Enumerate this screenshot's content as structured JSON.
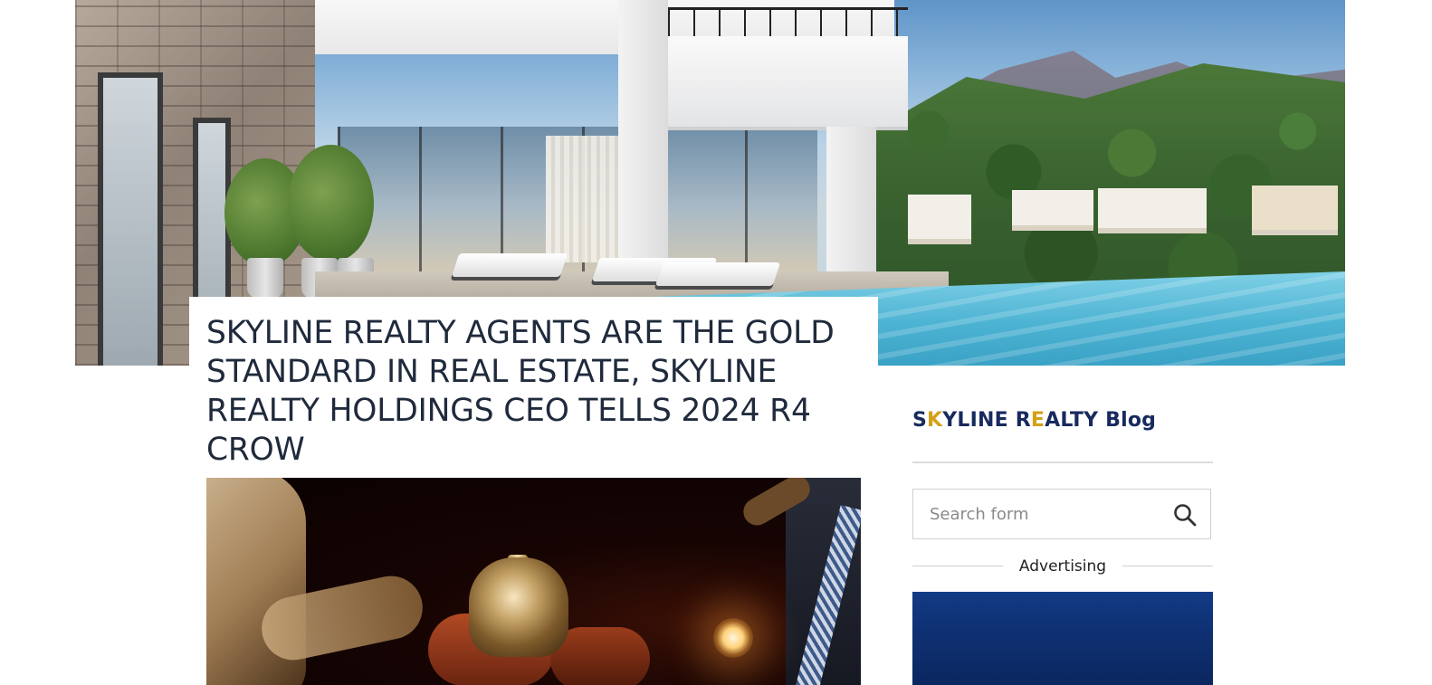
{
  "article": {
    "title": "SKYLINE REALTY AGENTS ARE THE GOLD STANDARD IN REAL ESTATE, SKYLINE REALTY HOLDINGS CEO TELLS 2024 R4 CROW"
  },
  "sidebar": {
    "blog_title_parts": [
      "S",
      "K",
      "YLINE R",
      "E",
      "ALTY Blog"
    ],
    "blog_title_accent_color": "#d4a017",
    "blog_title_color": "#182a5e",
    "search": {
      "placeholder": "Search form",
      "value": "",
      "icon": "search-icon"
    },
    "advertising_label": "Advertising"
  }
}
